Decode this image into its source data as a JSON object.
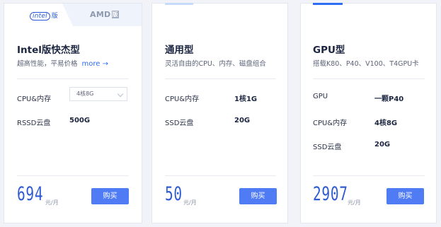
{
  "cards": [
    {
      "tabs": {
        "intel_text": "intel",
        "intel_suffix": "版",
        "amd_text": "AMD",
        "amd_suffix": "版"
      },
      "title": "Intel版快杰型",
      "subtitle": "超高性能，平易价格",
      "more_label": "more →",
      "specs": [
        {
          "label": "CPU&内存",
          "value": "4核8G"
        },
        {
          "label": "RSSD云盘",
          "value": "500G"
        }
      ],
      "price": "694",
      "unit": "元/月",
      "buy_label": "购买"
    },
    {
      "title": "通用型",
      "subtitle": "灵活自由的CPU、内存、磁盘组合",
      "specs": [
        {
          "label": "CPU&内存",
          "value": "1核1G"
        },
        {
          "label": "SSD云盘",
          "value": "20G"
        }
      ],
      "price": "50",
      "unit": "元/月",
      "buy_label": "购买"
    },
    {
      "title": "GPU型",
      "subtitle": "搭载K80、P40、V100、T4GPU卡",
      "specs": [
        {
          "label": "GPU",
          "value": "一颗P40"
        },
        {
          "label": "CPU&内存",
          "value": "4核8G"
        },
        {
          "label": "SSD云盘",
          "value": "20G"
        }
      ],
      "price": "2907",
      "unit": "元/月",
      "buy_label": "购买"
    }
  ],
  "colors": {
    "accent": "#2f6df4",
    "price": "#2f5bd2",
    "button": "#4f7cf5",
    "background": "#f1f3f8"
  }
}
